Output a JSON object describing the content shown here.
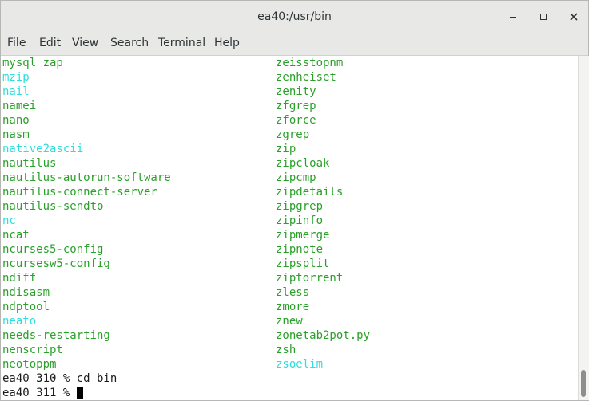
{
  "window": {
    "title": "ea40:/usr/bin"
  },
  "menu": {
    "file": "File",
    "edit": "Edit",
    "view": "View",
    "search": "Search",
    "terminal": "Terminal",
    "help": "Help"
  },
  "colors": {
    "executable": "#2aa02a",
    "symlink": "#2ddede",
    "prompt": "#1a1a1a",
    "background": "#ffffff"
  },
  "terminal": {
    "col1": [
      {
        "text": "mysql_zap",
        "kind": "exec"
      },
      {
        "text": "mzip",
        "kind": "link"
      },
      {
        "text": "nail",
        "kind": "link"
      },
      {
        "text": "namei",
        "kind": "exec"
      },
      {
        "text": "nano",
        "kind": "exec"
      },
      {
        "text": "nasm",
        "kind": "exec"
      },
      {
        "text": "native2ascii",
        "kind": "link"
      },
      {
        "text": "nautilus",
        "kind": "exec"
      },
      {
        "text": "nautilus-autorun-software",
        "kind": "exec"
      },
      {
        "text": "nautilus-connect-server",
        "kind": "exec"
      },
      {
        "text": "nautilus-sendto",
        "kind": "exec"
      },
      {
        "text": "nc",
        "kind": "link"
      },
      {
        "text": "ncat",
        "kind": "exec"
      },
      {
        "text": "ncurses5-config",
        "kind": "exec"
      },
      {
        "text": "ncursesw5-config",
        "kind": "exec"
      },
      {
        "text": "ndiff",
        "kind": "exec"
      },
      {
        "text": "ndisasm",
        "kind": "exec"
      },
      {
        "text": "ndptool",
        "kind": "exec"
      },
      {
        "text": "neato",
        "kind": "link"
      },
      {
        "text": "needs-restarting",
        "kind": "exec"
      },
      {
        "text": "nenscript",
        "kind": "exec"
      },
      {
        "text": "neotoppm",
        "kind": "exec"
      }
    ],
    "col2": [
      {
        "text": "zeisstopnm",
        "kind": "exec"
      },
      {
        "text": "zenheiset",
        "kind": "exec"
      },
      {
        "text": "zenity",
        "kind": "exec"
      },
      {
        "text": "zfgrep",
        "kind": "exec"
      },
      {
        "text": "zforce",
        "kind": "exec"
      },
      {
        "text": "zgrep",
        "kind": "exec"
      },
      {
        "text": "zip",
        "kind": "exec"
      },
      {
        "text": "zipcloak",
        "kind": "exec"
      },
      {
        "text": "zipcmp",
        "kind": "exec"
      },
      {
        "text": "zipdetails",
        "kind": "exec"
      },
      {
        "text": "zipgrep",
        "kind": "exec"
      },
      {
        "text": "zipinfo",
        "kind": "exec"
      },
      {
        "text": "zipmerge",
        "kind": "exec"
      },
      {
        "text": "zipnote",
        "kind": "exec"
      },
      {
        "text": "zipsplit",
        "kind": "exec"
      },
      {
        "text": "ziptorrent",
        "kind": "exec"
      },
      {
        "text": "zless",
        "kind": "exec"
      },
      {
        "text": "zmore",
        "kind": "exec"
      },
      {
        "text": "znew",
        "kind": "exec"
      },
      {
        "text": "zonetab2pot.py",
        "kind": "exec"
      },
      {
        "text": "zsh",
        "kind": "exec"
      },
      {
        "text": "zsoelim",
        "kind": "link"
      }
    ],
    "history": [
      "ea40 310 % cd bin"
    ],
    "prompt": "ea40 311 % "
  }
}
